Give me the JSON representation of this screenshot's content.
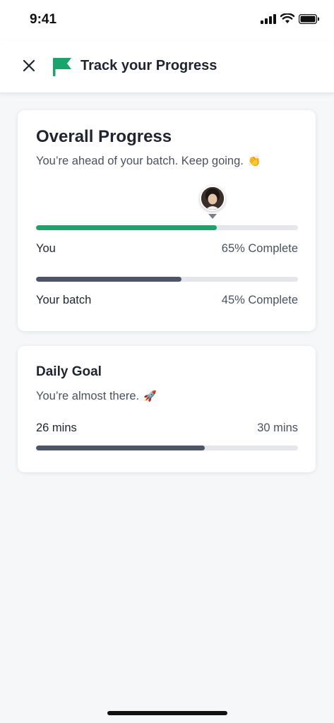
{
  "status_bar": {
    "time": "9:41"
  },
  "header": {
    "title": "Track your Progress"
  },
  "overall": {
    "title": "Overall Progress",
    "subtitle": "You’re ahead of your batch. Keep going.",
    "subtitle_emoji": "👏",
    "you": {
      "label": "You",
      "value_text": "65% Complete",
      "progress": 0.69,
      "color": "#18a46b"
    },
    "batch": {
      "label": "Your batch",
      "value_text": "45% Complete",
      "progress": 0.556,
      "color": "#4e5566"
    }
  },
  "daily": {
    "title": "Daily Goal",
    "subtitle": "You’re almost there.",
    "subtitle_emoji": "🚀",
    "current_label": "26 mins",
    "goal_label": "30 mins",
    "progress": 0.643,
    "color": "#4e5566"
  },
  "colors": {
    "accent": "#18a46b",
    "track": "#e4e6ea"
  }
}
